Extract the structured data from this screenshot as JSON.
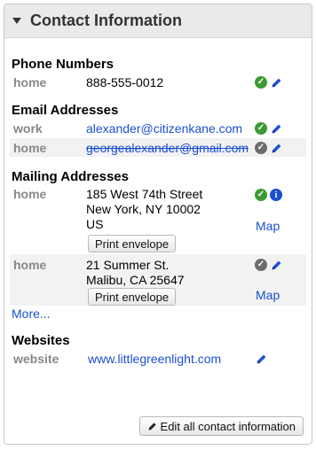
{
  "panel": {
    "title": "Contact Information",
    "icon": "caret-down-icon"
  },
  "phones": {
    "title": "Phone Numbers",
    "items": [
      {
        "label": "home",
        "value": "888-555-0012",
        "status": "verified"
      }
    ]
  },
  "emails": {
    "title": "Email Addresses",
    "items": [
      {
        "label": "work",
        "value": "alexander@citizenkane.com",
        "status": "verified"
      },
      {
        "label": "home",
        "value": "georgealexander@gmail.com",
        "status": "inactive"
      }
    ]
  },
  "addresses": {
    "title": "Mailing Addresses",
    "items": [
      {
        "label": "home",
        "lines": [
          "185 West 74th Street",
          "New York, NY 10002",
          "US"
        ],
        "button": "Print envelope",
        "map": "Map",
        "status": "verified"
      },
      {
        "label": "home",
        "lines": [
          "21 Summer St.",
          "Malibu, CA 25647"
        ],
        "button": "Print envelope",
        "map": "Map",
        "status": "inactive"
      }
    ],
    "more": "More..."
  },
  "websites": {
    "title": "Websites",
    "items": [
      {
        "label": "website",
        "value": "www.littlegreenlight.com"
      }
    ]
  },
  "footer": {
    "edit_all": "Edit all contact information"
  },
  "colors": {
    "accent_link": "#1a4fd1",
    "verified_green": "#3c9a32",
    "inactive_gray": "#6c6c6c"
  }
}
